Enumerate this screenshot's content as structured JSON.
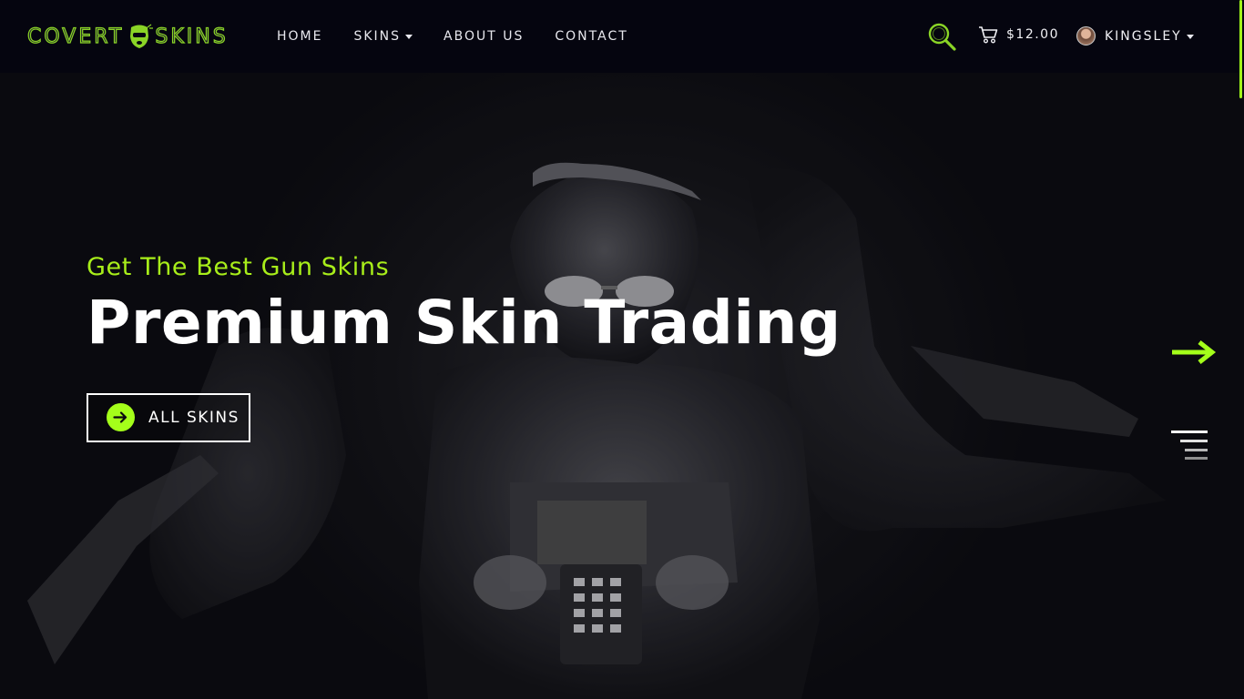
{
  "brand": {
    "name_left": "COVERT",
    "name_right": "SKINS",
    "accent": "#a4ff1a",
    "logo_icon": "balaclava-mask-icon"
  },
  "nav": {
    "items": [
      {
        "label": "HOME",
        "has_dropdown": false
      },
      {
        "label": "SKINS",
        "has_dropdown": true
      },
      {
        "label": "ABOUT US",
        "has_dropdown": false
      },
      {
        "label": "CONTACT",
        "has_dropdown": false
      }
    ]
  },
  "header": {
    "search_icon": "search-icon",
    "cart_icon": "cart-icon",
    "cart_total": "$12.00",
    "user_name": "KINGSLEY"
  },
  "hero": {
    "kicker": "Get The Best Gun Skins",
    "title": "Premium Skin Trading",
    "cta_label": "ALL SKINS",
    "cta_icon": "arrow-right-circle-icon",
    "next_icon": "arrow-right-icon",
    "menu_icon": "menu-lines-icon"
  }
}
